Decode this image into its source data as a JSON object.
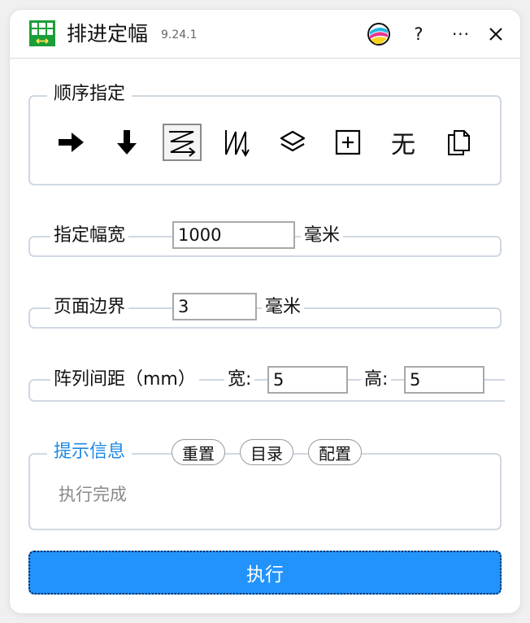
{
  "app": {
    "title": "排进定幅",
    "version": "9.24.1",
    "help": "?",
    "more": "···"
  },
  "order": {
    "legend": "顺序指定",
    "icons": [
      {
        "name": "arrow-right-icon"
      },
      {
        "name": "arrow-down-icon"
      },
      {
        "name": "zigzag-horizontal-icon",
        "selected": true
      },
      {
        "name": "zigzag-vertical-icon"
      },
      {
        "name": "layers-icon"
      },
      {
        "name": "plus-box-icon"
      },
      {
        "name": "none-text",
        "label": "无"
      },
      {
        "name": "copy-pages-icon"
      }
    ]
  },
  "width": {
    "label": "指定幅宽",
    "value": "1000",
    "unit": "毫米"
  },
  "margin": {
    "label": "页面边界",
    "value": "3",
    "unit": "毫米"
  },
  "spacing": {
    "label": "阵列间距（mm）",
    "width_label": "宽:",
    "width_value": "5",
    "height_label": "高:",
    "height_value": "5"
  },
  "info": {
    "legend": "提示信息",
    "reset": "重置",
    "directory": "目录",
    "config": "配置",
    "status": "执行完成"
  },
  "execute": {
    "label": "执行"
  },
  "colors": {
    "accent": "#2293fb",
    "info_blue": "#1e88e5",
    "border": "#d0d8e2"
  }
}
